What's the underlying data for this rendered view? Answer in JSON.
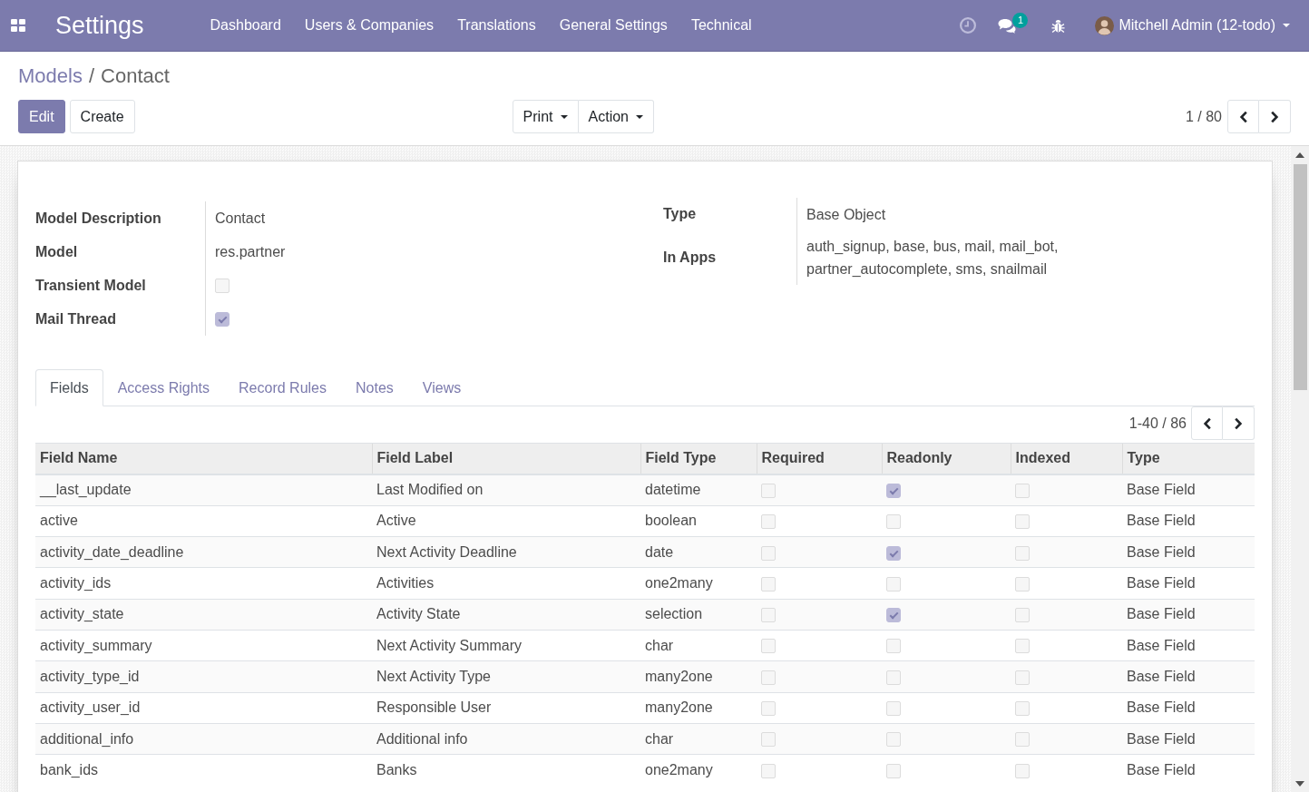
{
  "navbar": {
    "app_name": "Settings",
    "menu": [
      "Dashboard",
      "Users & Companies",
      "Translations",
      "General Settings",
      "Technical"
    ],
    "messages_badge": "1",
    "user_name": "Mitchell Admin (12-todo)"
  },
  "control_panel": {
    "breadcrumb": [
      {
        "label": "Models",
        "kind": "link"
      },
      {
        "label": "Contact",
        "kind": "current"
      }
    ],
    "breadcrumb_separator": "/",
    "buttons": [
      {
        "label": "Edit",
        "kind": "primary"
      },
      {
        "label": "Create",
        "kind": "secondary"
      }
    ],
    "dropdowns": [
      "Print",
      "Action"
    ],
    "pager": "1 / 80"
  },
  "sheet": {
    "left_group": [
      {
        "label": "Model Description",
        "kind": "text",
        "value": "Contact"
      },
      {
        "label": "Model",
        "kind": "text",
        "value": "res.partner"
      },
      {
        "label": "Transient Model",
        "kind": "checkbox",
        "checked": false
      },
      {
        "label": "Mail Thread",
        "kind": "checkbox",
        "checked": true
      }
    ],
    "right_group": [
      {
        "label": "Type",
        "kind": "text",
        "value": "Base Object"
      },
      {
        "label": "In Apps",
        "kind": "text",
        "value": "auth_signup, base, bus, mail, mail_bot, partner_autocomplete, sms, snailmail"
      }
    ],
    "tabs": [
      {
        "label": "Fields",
        "selected": true
      },
      {
        "label": "Access Rights",
        "selected": false
      },
      {
        "label": "Record Rules",
        "selected": false
      },
      {
        "label": "Notes",
        "selected": false
      },
      {
        "label": "Views",
        "selected": false
      }
    ],
    "fields_pager": "1-40 / 86",
    "table": {
      "columns": [
        "Field Name",
        "Field Label",
        "Field Type",
        "Required",
        "Readonly",
        "Indexed",
        "Type"
      ],
      "rows": [
        {
          "field_name": "__last_update",
          "field_label": "Last Modified on",
          "field_type": "datetime",
          "required": false,
          "readonly": true,
          "indexed": false,
          "type": "Base Field"
        },
        {
          "field_name": "active",
          "field_label": "Active",
          "field_type": "boolean",
          "required": false,
          "readonly": false,
          "indexed": false,
          "type": "Base Field"
        },
        {
          "field_name": "activity_date_deadline",
          "field_label": "Next Activity Deadline",
          "field_type": "date",
          "required": false,
          "readonly": true,
          "indexed": false,
          "type": "Base Field"
        },
        {
          "field_name": "activity_ids",
          "field_label": "Activities",
          "field_type": "one2many",
          "required": false,
          "readonly": false,
          "indexed": false,
          "type": "Base Field"
        },
        {
          "field_name": "activity_state",
          "field_label": "Activity State",
          "field_type": "selection",
          "required": false,
          "readonly": true,
          "indexed": false,
          "type": "Base Field"
        },
        {
          "field_name": "activity_summary",
          "field_label": "Next Activity Summary",
          "field_type": "char",
          "required": false,
          "readonly": false,
          "indexed": false,
          "type": "Base Field"
        },
        {
          "field_name": "activity_type_id",
          "field_label": "Next Activity Type",
          "field_type": "many2one",
          "required": false,
          "readonly": false,
          "indexed": false,
          "type": "Base Field"
        },
        {
          "field_name": "activity_user_id",
          "field_label": "Responsible User",
          "field_type": "many2one",
          "required": false,
          "readonly": false,
          "indexed": false,
          "type": "Base Field"
        },
        {
          "field_name": "additional_info",
          "field_label": "Additional info",
          "field_type": "char",
          "required": false,
          "readonly": false,
          "indexed": false,
          "type": "Base Field"
        },
        {
          "field_name": "bank_ids",
          "field_label": "Banks",
          "field_type": "one2many",
          "required": false,
          "readonly": false,
          "indexed": false,
          "type": "Base Field"
        }
      ]
    }
  }
}
